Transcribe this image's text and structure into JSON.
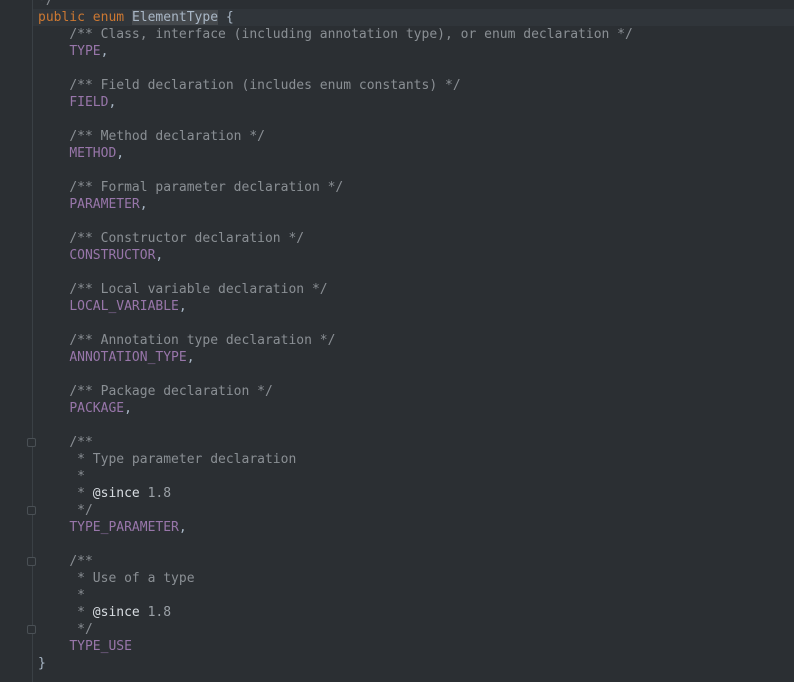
{
  "code": {
    "prev_comment_tail": "*/",
    "decl": {
      "kw_public": "public",
      "kw_enum": "enum",
      "class_name": "ElementType",
      "open_brace": "{"
    },
    "entries": [
      {
        "comment": "/** Class, interface (including annotation type), or enum declaration */",
        "name": "TYPE",
        "sep": ","
      },
      {
        "comment": "/** Field declaration (includes enum constants) */",
        "name": "FIELD",
        "sep": ","
      },
      {
        "comment": "/** Method declaration */",
        "name": "METHOD",
        "sep": ","
      },
      {
        "comment": "/** Formal parameter declaration */",
        "name": "PARAMETER",
        "sep": ","
      },
      {
        "comment": "/** Constructor declaration */",
        "name": "CONSTRUCTOR",
        "sep": ","
      },
      {
        "comment": "/** Local variable declaration */",
        "name": "LOCAL_VARIABLE",
        "sep": ","
      },
      {
        "comment": "/** Annotation type declaration */",
        "name": "ANNOTATION_TYPE",
        "sep": ","
      },
      {
        "comment": "/** Package declaration */",
        "name": "PACKAGE",
        "sep": ","
      }
    ],
    "javadoc_blocks": [
      {
        "open": "/**",
        "description": " * Type parameter declaration",
        "empty": " *",
        "since_prefix": " * ",
        "since_tag": "@since",
        "since_value": "1.8",
        "close": " */",
        "name": "TYPE_PARAMETER",
        "sep": ","
      },
      {
        "open": "/**",
        "description": " * Use of a type",
        "empty": " *",
        "since_prefix": " * ",
        "since_tag": "@since",
        "since_value": "1.8",
        "close": " */",
        "name": "TYPE_USE",
        "sep": ""
      }
    ],
    "close_brace": "}"
  },
  "colors": {
    "background": "#2b2f33",
    "keyword": "#cc7832",
    "comment": "#8a8f94",
    "constant": "#9876aa",
    "text": "#a9b7c6"
  }
}
